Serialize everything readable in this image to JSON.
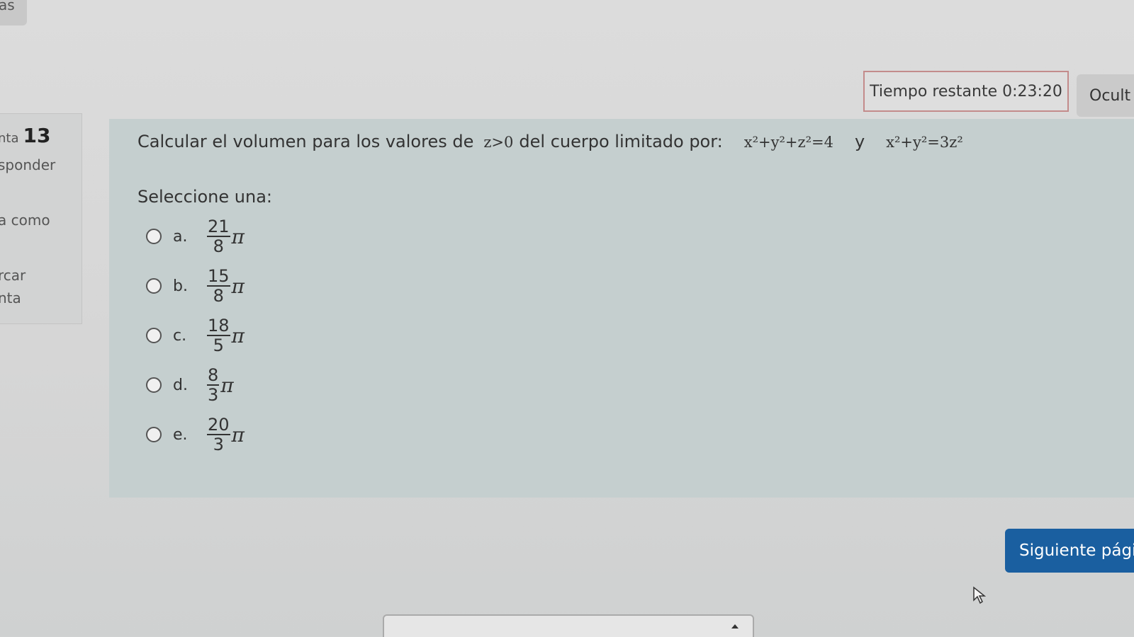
{
  "top_tab": {
    "label": "as"
  },
  "timer": {
    "label": "Tiempo restante 0:23:20"
  },
  "hide_button": {
    "label": "Ocult"
  },
  "info_panel": {
    "question_prefix": "nta",
    "question_number": "13",
    "status": "sponder",
    "score": "a como",
    "flag_line1": "rcar",
    "flag_line2": "nta"
  },
  "question": {
    "text_before": "Calcular el volumen para los valores de",
    "condition": "z>0",
    "text_after": "del cuerpo limitado por:",
    "equation1": "x²+y²+z²=4",
    "connector": "y",
    "equation2": "x²+y²=3z²"
  },
  "prompt": "Seleccione una:",
  "options": [
    {
      "letter": "a.",
      "numerator": "21",
      "denominator": "8",
      "symbol": "π"
    },
    {
      "letter": "b.",
      "numerator": "15",
      "denominator": "8",
      "symbol": "π"
    },
    {
      "letter": "c.",
      "numerator": "18",
      "denominator": "5",
      "symbol": "π"
    },
    {
      "letter": "d.",
      "numerator": "8",
      "denominator": "3",
      "symbol": "π"
    },
    {
      "letter": "e.",
      "numerator": "20",
      "denominator": "3",
      "symbol": "π"
    }
  ],
  "next_button": {
    "label": "Siguiente pági"
  },
  "icons": {
    "cursor": "mouse-pointer-icon",
    "select_caret": "caret-up-icon",
    "radio": "radio-unchecked-icon"
  },
  "colors": {
    "panel_bg": "#c5cfcf",
    "primary_button": "#1a5fa0",
    "timer_border": "#c38b8b"
  }
}
